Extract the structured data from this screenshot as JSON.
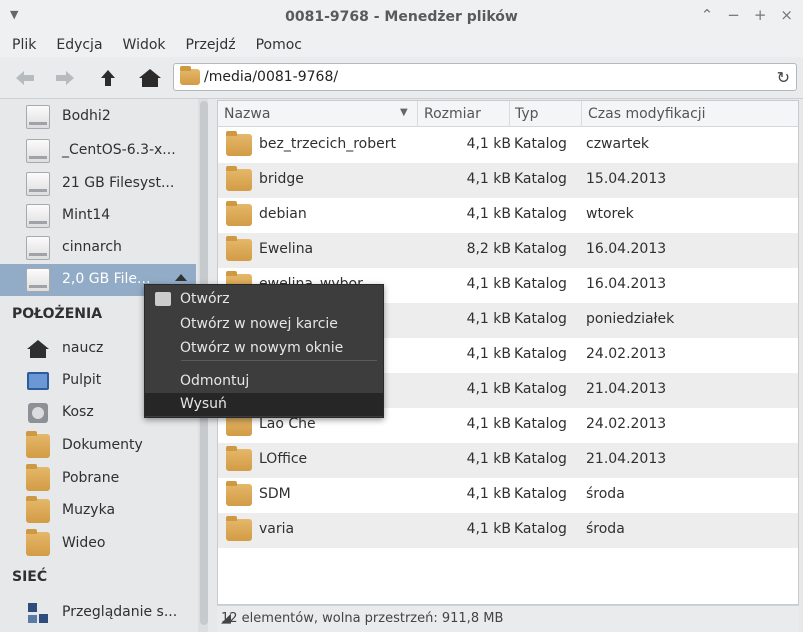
{
  "window": {
    "title": "0081-9768 - Menedżer plików"
  },
  "menubar": [
    "Plik",
    "Edycja",
    "Widok",
    "Przejdź",
    "Pomoc"
  ],
  "address": {
    "path": "/media/0081-9768/"
  },
  "sidebar": {
    "devices": [
      {
        "label": "Bodhi2",
        "icon": "drive-icon"
      },
      {
        "label": "_CentOS-6.3-x...",
        "icon": "drive-icon"
      },
      {
        "label": "21 GB Filesyst...",
        "icon": "drive-icon"
      },
      {
        "label": "Mint14",
        "icon": "drive-icon"
      },
      {
        "label": "cinnarch",
        "icon": "drive-icon"
      },
      {
        "label": "2,0 GB File...",
        "icon": "usb-drive-icon",
        "selected": true
      }
    ],
    "places_header": "POŁOŻENIA",
    "places": [
      {
        "label": "naucz",
        "icon": "home-icon"
      },
      {
        "label": "Pulpit",
        "icon": "desktop-icon"
      },
      {
        "label": "Kosz",
        "icon": "trash-icon"
      },
      {
        "label": "Dokumenty",
        "icon": "documents-folder-icon"
      },
      {
        "label": "Pobrane",
        "icon": "downloads-folder-icon"
      },
      {
        "label": "Muzyka",
        "icon": "music-folder-icon"
      },
      {
        "label": "Wideo",
        "icon": "video-folder-icon"
      }
    ],
    "network_header": "SIEĆ",
    "network": [
      {
        "label": "Przeglądanie s...",
        "icon": "network-icon"
      }
    ]
  },
  "columns": {
    "name": "Nazwa",
    "size": "Rozmiar",
    "type": "Typ",
    "modified": "Czas modyfikacji"
  },
  "files": [
    {
      "name": "bez_trzecich_robert",
      "size": "4,1 kB",
      "type": "Katalog",
      "modified": "czwartek"
    },
    {
      "name": "bridge",
      "size": "4,1 kB",
      "type": "Katalog",
      "modified": "15.04.2013"
    },
    {
      "name": "debian",
      "size": "4,1 kB",
      "type": "Katalog",
      "modified": "wtorek"
    },
    {
      "name": "Ewelina",
      "size": "8,2 kB",
      "type": "Katalog",
      "modified": "16.04.2013"
    },
    {
      "name": "ewelina_wybor",
      "size": "4,1 kB",
      "type": "Katalog",
      "modified": "16.04.2013"
    },
    {
      "name": "",
      "size": "4,1 kB",
      "type": "Katalog",
      "modified": "poniedziałek"
    },
    {
      "name": "",
      "size": "4,1 kB",
      "type": "Katalog",
      "modified": "24.02.2013"
    },
    {
      "name": "",
      "size": "4,1 kB",
      "type": "Katalog",
      "modified": "21.04.2013"
    },
    {
      "name": "Lao Che",
      "size": "4,1 kB",
      "type": "Katalog",
      "modified": "24.02.2013"
    },
    {
      "name": "LOffice",
      "size": "4,1 kB",
      "type": "Katalog",
      "modified": "21.04.2013"
    },
    {
      "name": "SDM",
      "size": "4,1 kB",
      "type": "Katalog",
      "modified": "środa"
    },
    {
      "name": "varia",
      "size": "4,1 kB",
      "type": "Katalog",
      "modified": "środa"
    }
  ],
  "status": "12 elementów, wolna przestrzeń: 911,8 MB",
  "context_menu": {
    "items": [
      "Otwórz",
      "Otwórz w nowej karcie",
      "Otwórz w nowym oknie",
      "Odmontuj",
      "Wysuń"
    ],
    "hovered": "Wysuń"
  }
}
